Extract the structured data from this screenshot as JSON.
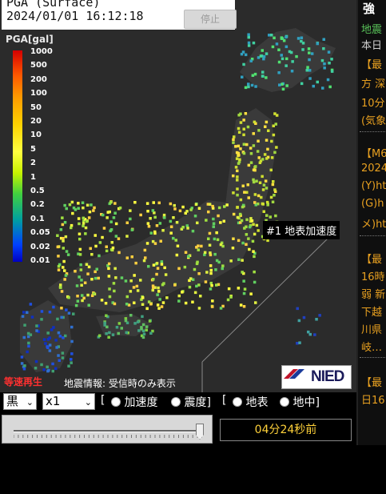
{
  "header": {
    "line1": "PGA (Surface)",
    "line2": "2024/01/01 16:12:18",
    "stop_button": "停止"
  },
  "scale": {
    "title": "PGA[gal]",
    "labels": [
      "1000",
      "500",
      "200",
      "100",
      "50",
      "20",
      "10",
      "5",
      "2",
      "1",
      "0.5",
      "0.2",
      "0.1",
      "0.05",
      "0.02",
      "0.01"
    ]
  },
  "map": {
    "annotation": "#1 地表加速度",
    "speed_label": "等速再生",
    "eq_info": "地震情報: 受信時のみ表示",
    "logo_text": "NIED"
  },
  "controls": {
    "color_select": "黒",
    "speed_select": "x1",
    "bracket_open": "[",
    "radio_accel": "加速度",
    "radio_intensity": "震度]",
    "bracket_open2": "[",
    "radio_surface": "地表",
    "radio_underground": "地中]"
  },
  "timebar": {
    "elapsed": "04分24秒前"
  },
  "sidebar": {
    "title": "強",
    "lines": [
      {
        "text": "地震",
        "color": "#58c058"
      },
      {
        "text": "本日",
        "color": "#cfcfcf"
      },
      {
        "text": "【最",
        "color": "#e8a020"
      },
      {
        "text": "方 深",
        "color": "#e8a020"
      },
      {
        "text": "10分",
        "color": "#e8a020"
      },
      {
        "text": "(気象",
        "color": "#e8a020"
      },
      {
        "text": "【M6",
        "color": "#e8a020"
      },
      {
        "text": "2024",
        "color": "#e8a020"
      },
      {
        "text": "(Y)ht",
        "color": "#e8a020"
      },
      {
        "text": "(G)h",
        "color": "#e8a020"
      },
      {
        "text": "メ)ht",
        "color": "#e8a020"
      },
      {
        "text": "【最",
        "color": "#e8a020"
      },
      {
        "text": "16時",
        "color": "#e8a020"
      },
      {
        "text": "弱 新",
        "color": "#e8a020"
      },
      {
        "text": "下越",
        "color": "#e8a020"
      },
      {
        "text": "川県",
        "color": "#e8a020"
      },
      {
        "text": "岐…",
        "color": "#e8a020"
      },
      {
        "text": "【最",
        "color": "#e8a020"
      },
      {
        "text": "日16",
        "color": "#e8a020"
      }
    ]
  }
}
